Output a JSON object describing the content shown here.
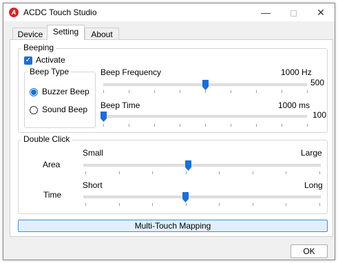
{
  "window": {
    "title": "ACDC Touch Studio",
    "icon_name": "acdc-logo-icon",
    "controls": [
      "minimize",
      "maximize",
      "close"
    ]
  },
  "tabs": [
    {
      "label": "Device",
      "active": false
    },
    {
      "label": "Setting",
      "active": true
    },
    {
      "label": "About",
      "active": false
    }
  ],
  "beeping": {
    "group_label": "Beeping",
    "activate_label": "Activate",
    "activate_checked": true,
    "beep_type": {
      "group_label": "Beep Type",
      "options": [
        {
          "label": "Buzzer Beep",
          "selected": true
        },
        {
          "label": "Sound Beep",
          "selected": false
        }
      ]
    },
    "frequency": {
      "label": "Beep Frequency",
      "value_text": "1000 Hz",
      "max_text": "500",
      "level": 0.5
    },
    "time": {
      "label": "Beep Time",
      "value_text": "1000 ms",
      "max_text": "100",
      "level": 0.0
    }
  },
  "double_click": {
    "group_label": "Double Click",
    "area": {
      "row_label": "Area",
      "min_text": "Small",
      "max_text": "Large",
      "level": 0.44
    },
    "time": {
      "row_label": "Time",
      "min_text": "Short",
      "max_text": "Long",
      "level": 0.43
    }
  },
  "buttons": {
    "mapping_label": "Multi-Touch Mapping",
    "ok_label": "OK"
  },
  "colors": {
    "accent": "#1a6fd6",
    "logo": "#d6262b",
    "mapping_button_bg": "#e1effa"
  }
}
